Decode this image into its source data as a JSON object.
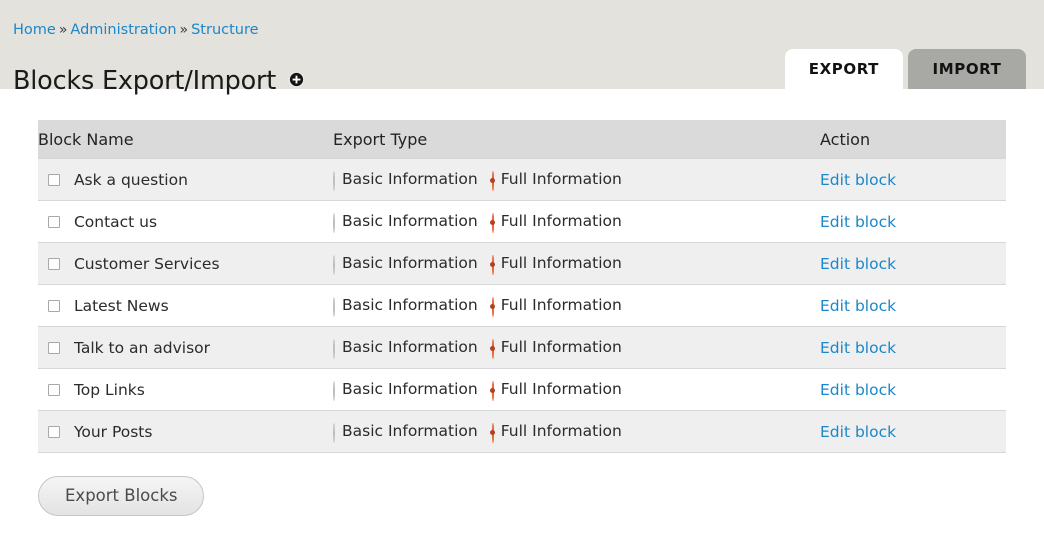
{
  "header": {
    "breadcrumb": [
      {
        "label": "Home"
      },
      {
        "label": "Administration"
      },
      {
        "label": "Structure"
      }
    ],
    "breadcrumb_separator": "»",
    "title": "Blocks Export/Import",
    "title_icon": "plus-circle-icon"
  },
  "tabs": [
    {
      "label": "EXPORT",
      "active": true
    },
    {
      "label": "IMPORT",
      "active": false
    }
  ],
  "table": {
    "columns": [
      "Block Name",
      "Export Type",
      "Action"
    ],
    "export_type_options": [
      "Basic Information",
      "Full Information"
    ],
    "action_label": "Edit block",
    "rows": [
      {
        "name": "Ask a question",
        "checked": false,
        "export_type": "Full Information",
        "action": "Edit block"
      },
      {
        "name": "Contact us",
        "checked": false,
        "export_type": "Full Information",
        "action": "Edit block"
      },
      {
        "name": "Customer Services",
        "checked": false,
        "export_type": "Full Information",
        "action": "Edit block"
      },
      {
        "name": "Latest News",
        "checked": false,
        "export_type": "Full Information",
        "action": "Edit block"
      },
      {
        "name": "Talk to an advisor",
        "checked": false,
        "export_type": "Full Information",
        "action": "Edit block"
      },
      {
        "name": "Top Links",
        "checked": false,
        "export_type": "Full Information",
        "action": "Edit block"
      },
      {
        "name": "Your Posts",
        "checked": false,
        "export_type": "Full Information",
        "action": "Edit block"
      }
    ]
  },
  "footer": {
    "submit_label": "Export Blocks"
  },
  "colors": {
    "header_band": "#e4e2dc",
    "tab_active": "#ffffff",
    "tab_inactive": "#a8a8a5",
    "link": "#1b87c8",
    "table_header": "#dadada",
    "row_odd": "#efefef",
    "row_even": "#ffffff",
    "radio_accent": "#e8673a"
  }
}
